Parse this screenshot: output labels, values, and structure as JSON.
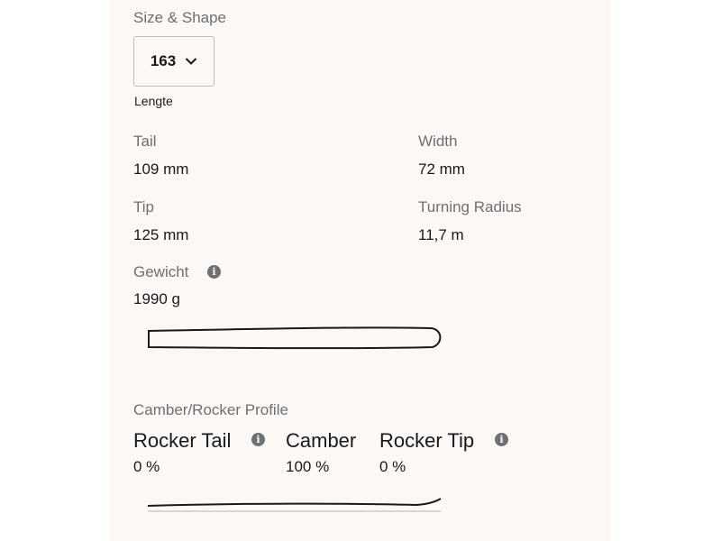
{
  "size_shape": {
    "heading": "Size & Shape",
    "length_selected": "163",
    "length_caption": "Lengte"
  },
  "specs": {
    "tail_label": "Tail",
    "tail_value": "109 mm",
    "width_label": "Width",
    "width_value": "72 mm",
    "tip_label": "Tip",
    "tip_value": "125 mm",
    "radius_label": "Turning Radius",
    "radius_value": "11,7 m",
    "weight_label": "Gewicht",
    "weight_value": "1990 g"
  },
  "profile": {
    "heading": "Camber/Rocker Profile",
    "rocker_tail_label": "Rocker Tail",
    "rocker_tail_value": "0 %",
    "camber_label": "Camber",
    "camber_value": "100 %",
    "rocker_tip_label": "Rocker Tip",
    "rocker_tip_value": "0 %"
  },
  "icons": {
    "info": "i",
    "dropdown": "chevron-down-icon"
  },
  "colors": {
    "panel_background": "#fcf8f6",
    "label_gray": "#6f6f6f",
    "text_dark": "#1a1a1a",
    "info_icon": "#707070"
  }
}
